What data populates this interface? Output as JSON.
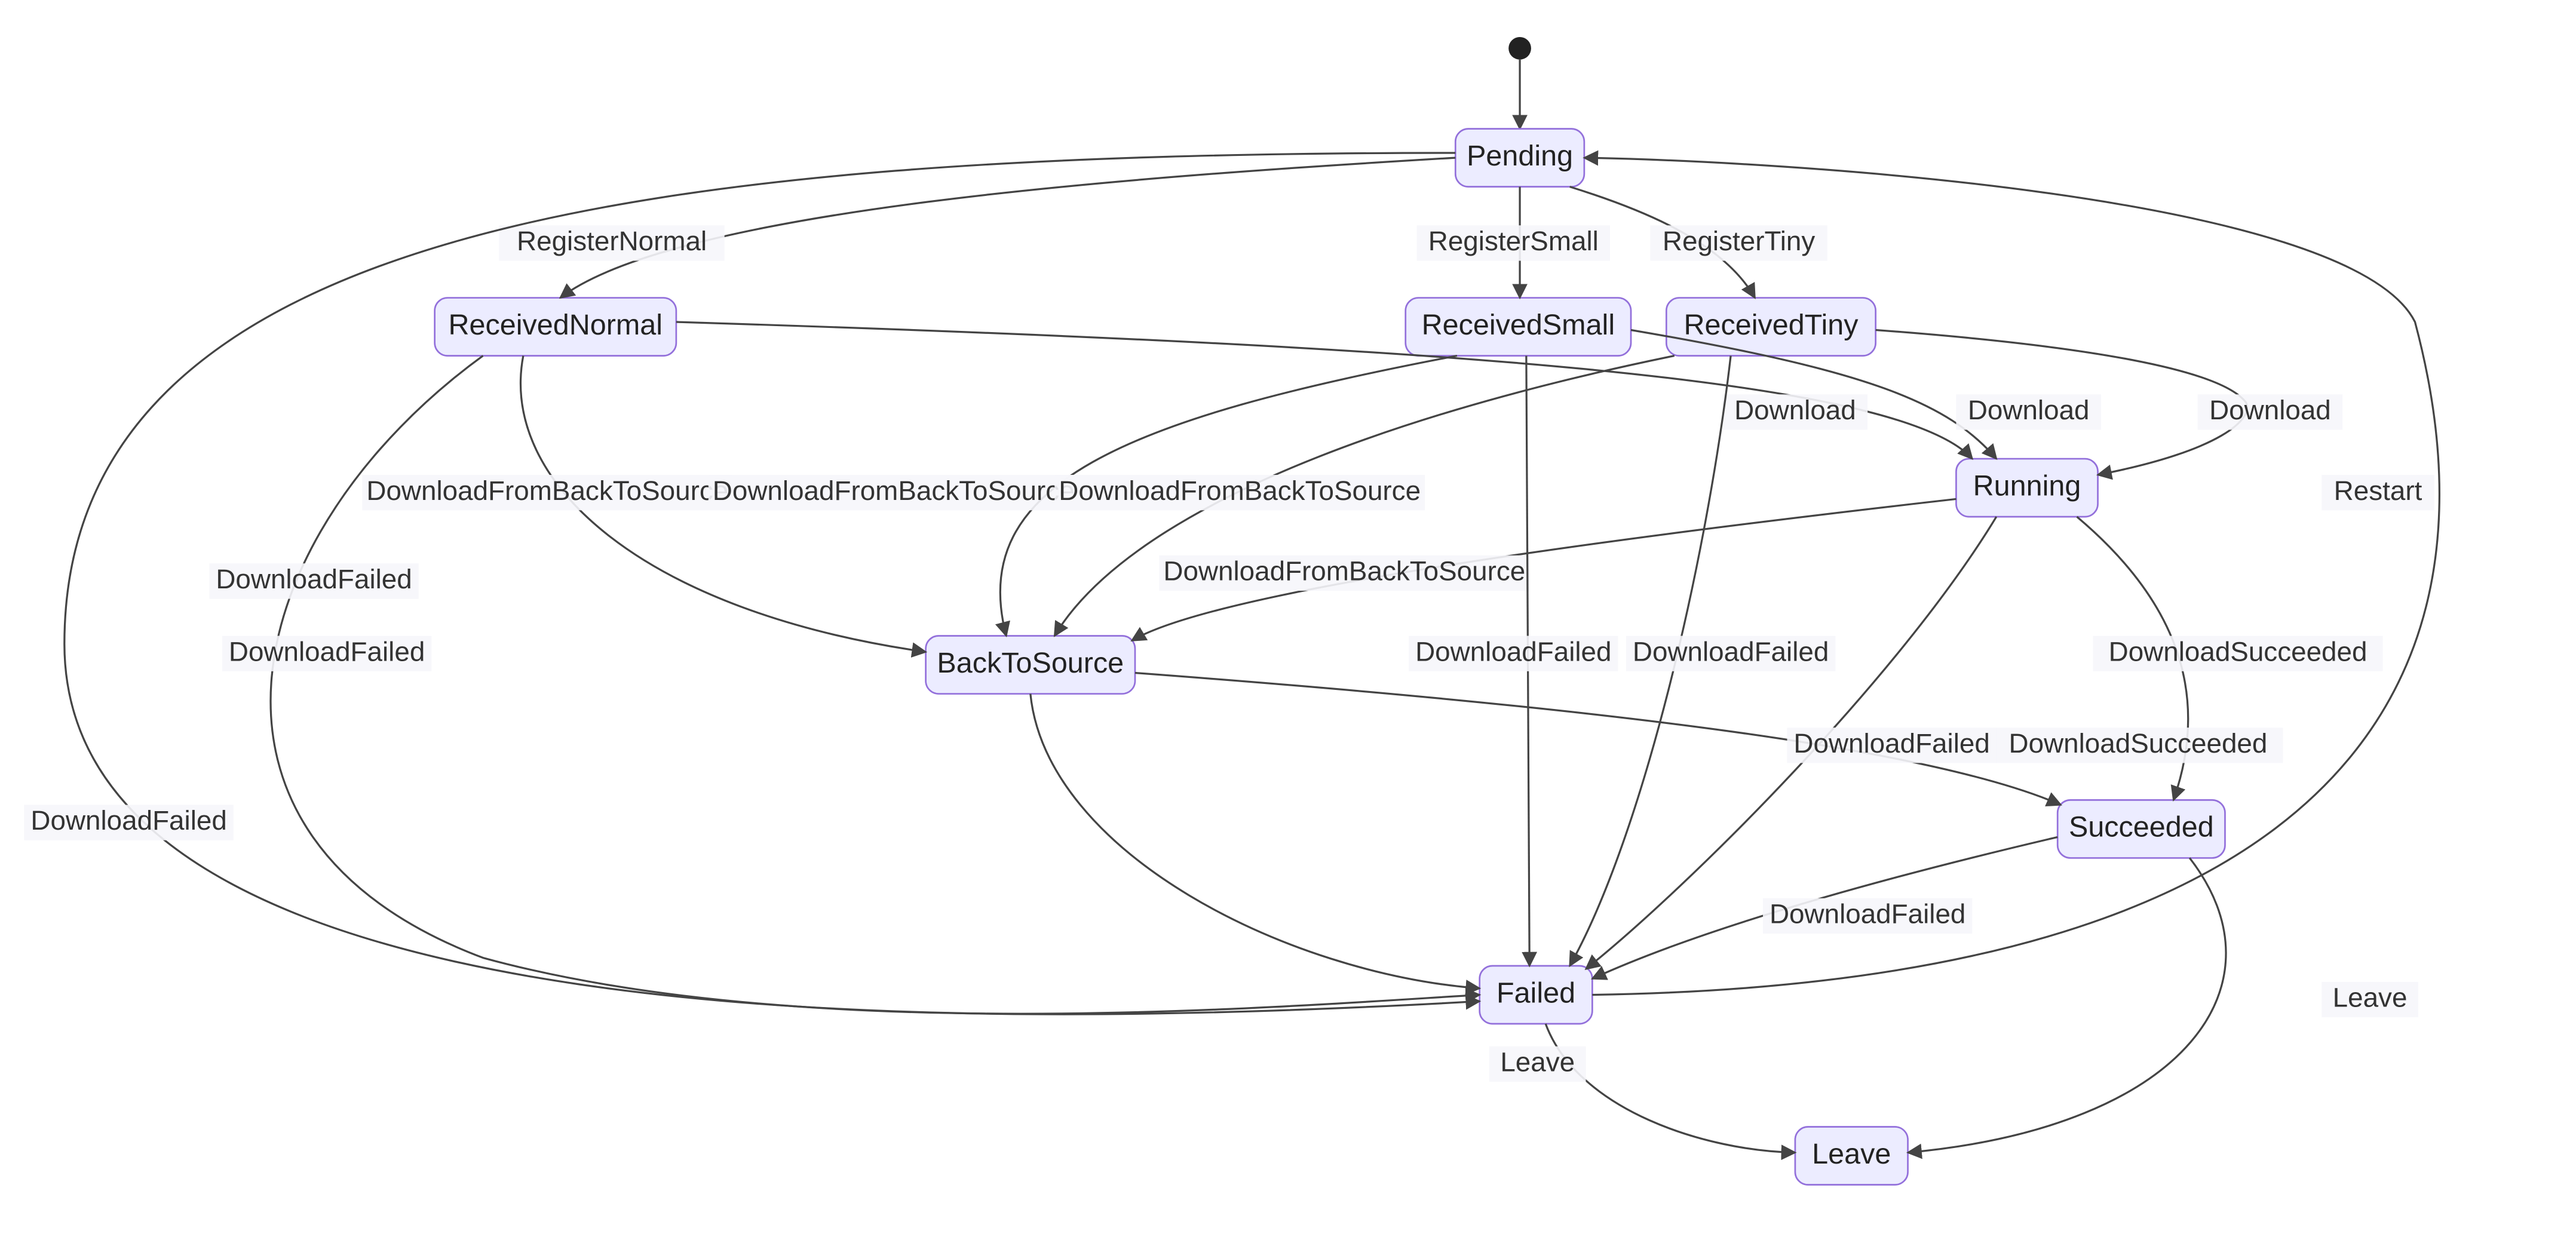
{
  "chart_data": {
    "type": "state-diagram",
    "initial": "Pending",
    "states": [
      "Pending",
      "ReceivedNormal",
      "ReceivedSmall",
      "ReceivedTiny",
      "Running",
      "BackToSource",
      "Succeeded",
      "Failed",
      "Leave"
    ],
    "transitions": [
      {
        "from": "__start__",
        "to": "Pending",
        "label": ""
      },
      {
        "from": "Pending",
        "to": "ReceivedNormal",
        "label": "RegisterNormal"
      },
      {
        "from": "Pending",
        "to": "ReceivedSmall",
        "label": "RegisterSmall"
      },
      {
        "from": "Pending",
        "to": "ReceivedTiny",
        "label": "RegisterTiny"
      },
      {
        "from": "ReceivedNormal",
        "to": "Running",
        "label": "Download"
      },
      {
        "from": "ReceivedSmall",
        "to": "Running",
        "label": "Download"
      },
      {
        "from": "ReceivedTiny",
        "to": "Running",
        "label": "Download"
      },
      {
        "from": "ReceivedNormal",
        "to": "BackToSource",
        "label": "DownloadFromBackToSource"
      },
      {
        "from": "ReceivedSmall",
        "to": "BackToSource",
        "label": "DownloadFromBackToSource"
      },
      {
        "from": "ReceivedTiny",
        "to": "BackToSource",
        "label": "DownloadFromBackToSource"
      },
      {
        "from": "Running",
        "to": "BackToSource",
        "label": "DownloadFromBackToSource"
      },
      {
        "from": "Running",
        "to": "Succeeded",
        "label": "DownloadSucceeded"
      },
      {
        "from": "BackToSource",
        "to": "Succeeded",
        "label": "DownloadSucceeded"
      },
      {
        "from": "ReceivedNormal",
        "to": "Failed",
        "label": "DownloadFailed"
      },
      {
        "from": "ReceivedSmall",
        "to": "Failed",
        "label": "DownloadFailed"
      },
      {
        "from": "ReceivedTiny",
        "to": "Failed",
        "label": "DownloadFailed"
      },
      {
        "from": "Running",
        "to": "Failed",
        "label": "DownloadFailed"
      },
      {
        "from": "BackToSource",
        "to": "Failed",
        "label": "DownloadFailed"
      },
      {
        "from": "Succeeded",
        "to": "Failed",
        "label": "DownloadFailed"
      },
      {
        "from": "Pending",
        "to": "Failed",
        "label": "DownloadFailed"
      },
      {
        "from": "Failed",
        "to": "Pending",
        "label": "Restart"
      },
      {
        "from": "Failed",
        "to": "Leave",
        "label": "Leave"
      },
      {
        "from": "Succeeded",
        "to": "Leave",
        "label": "Leave"
      }
    ]
  },
  "states": {
    "Pending": "Pending",
    "ReceivedNormal": "ReceivedNormal",
    "ReceivedSmall": "ReceivedSmall",
    "ReceivedTiny": "ReceivedTiny",
    "Running": "Running",
    "BackToSource": "BackToSource",
    "Succeeded": "Succeeded",
    "Failed": "Failed",
    "Leave": "Leave"
  },
  "labels": {
    "RegisterNormal": "RegisterNormal",
    "RegisterSmall": "RegisterSmall",
    "RegisterTiny": "RegisterTiny",
    "Download1": "Download",
    "Download2": "Download",
    "Download3": "Download",
    "DFBTS1": "DownloadFromBackToSource",
    "DFBTS2": "DownloadFromBackToSource",
    "DFBTS3": "DownloadFromBackToSource",
    "DFBTS4": "DownloadFromBackToSource",
    "DownloadSucceeded1": "DownloadSucceeded",
    "DownloadSucceeded2": "DownloadSucceeded",
    "DownloadFailedRN": "DownloadFailed",
    "DownloadFailedRS": "DownloadFailed",
    "DownloadFailedRT": "DownloadFailed",
    "DownloadFailedRun": "DownloadFailed",
    "DownloadFailedBTS": "DownloadFailed",
    "DownloadFailedSucc": "DownloadFailed",
    "DownloadFailedPend": "DownloadFailed",
    "Restart": "Restart",
    "LeaveF": "Leave",
    "LeaveS": "Leave"
  }
}
